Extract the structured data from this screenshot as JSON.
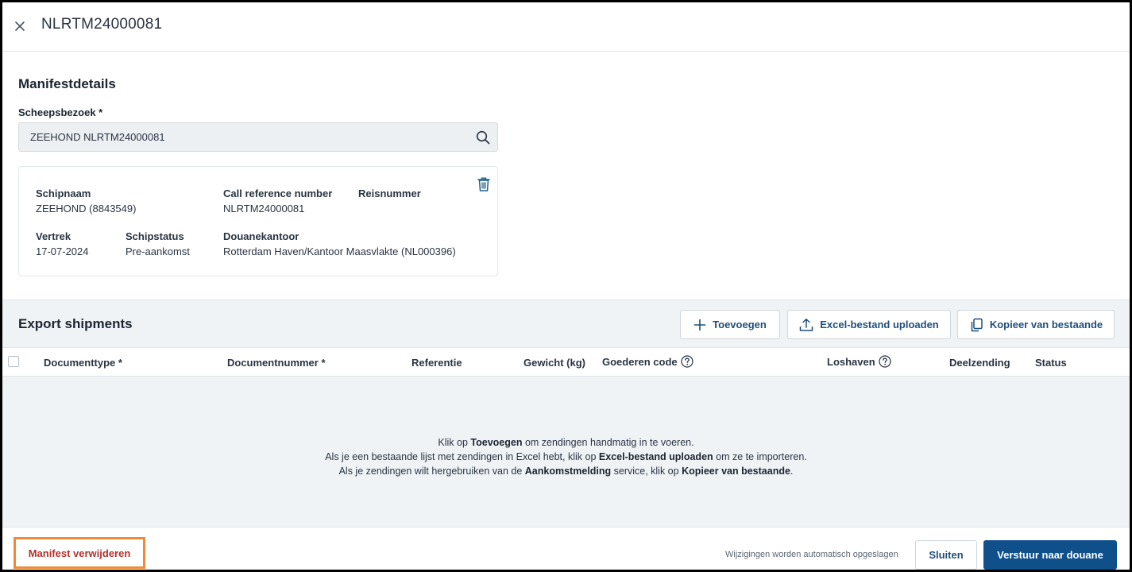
{
  "header": {
    "title": "NLRTM24000081"
  },
  "manifest": {
    "section_title": "Manifestdetails",
    "ship_visit_label": "Scheepsbezoek *",
    "ship_visit_value": "ZEEHOND NLRTM24000081",
    "ship_card": {
      "ship_name_label": "Schipnaam",
      "ship_name_value": "ZEEHOND (8843549)",
      "call_ref_label": "Call reference number",
      "call_ref_value": "NLRTM24000081",
      "voyage_label": "Reisnummer",
      "departure_label": "Vertrek",
      "departure_value": "17-07-2024",
      "ship_status_label": "Schipstatus",
      "ship_status_value": "Pre-aankomst",
      "customs_office_label": "Douanekantoor",
      "customs_office_value": "Rotterdam Haven/Kantoor Maasvlakte (NL000396)"
    }
  },
  "export": {
    "title": "Export shipments",
    "buttons": {
      "add": "Toevoegen",
      "upload": "Excel-bestand uploaden",
      "copy": "Kopieer van bestaande"
    },
    "columns": [
      "Documenttype *",
      "Documentnummer *",
      "Referentie",
      "Gewicht (kg)",
      "Goederen code",
      "Loshaven",
      "Deelzending",
      "Status"
    ],
    "empty": {
      "line1_pre": "Klik op ",
      "line1_bold": "Toevoegen",
      "line1_post": " om zendingen handmatig in te voeren.",
      "line2_pre": "Als je een bestaande lijst met zendingen in Excel hebt, klik op ",
      "line2_bold": "Excel-bestand uploaden",
      "line2_post": " om ze te importeren.",
      "line3_pre": "Als je zendingen wilt hergebruiken van de ",
      "line3_bold1": "Aankomstmelding",
      "line3_mid": " service, klik op ",
      "line3_bold2": "Kopieer van bestaande",
      "line3_post": "."
    }
  },
  "footer": {
    "delete_label": "Manifest verwijderen",
    "autosave_text": "Wijzigingen worden automatisch opgeslagen",
    "close_label": "Sluiten",
    "send_label": "Verstuur naar douane"
  },
  "colors": {
    "primary": "#0f4f8a",
    "danger_text": "#b5302a",
    "highlight_border": "#f08a36"
  }
}
